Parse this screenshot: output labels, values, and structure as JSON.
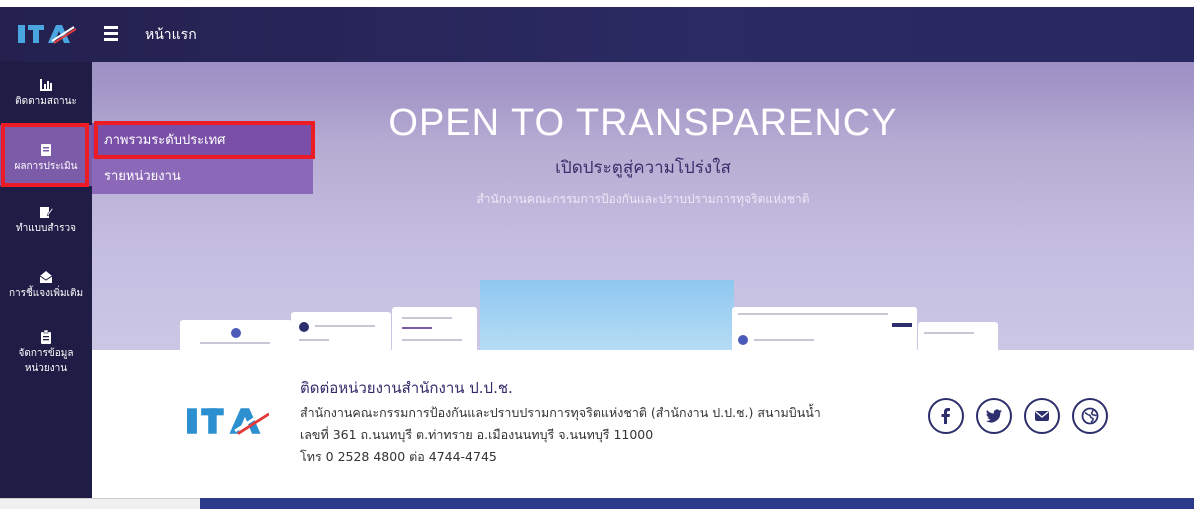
{
  "header": {
    "title": "หน้าแรก"
  },
  "sidebar": {
    "items": [
      {
        "label": "ติดตามสถานะ",
        "icon": "chart-icon"
      },
      {
        "label": "ผลการประเมิน",
        "icon": "document-icon"
      },
      {
        "label": "ทำแบบสำรวจ",
        "icon": "edit-icon"
      },
      {
        "label": "การชี้แจงเพิ่มเติม",
        "icon": "mail-open-icon"
      },
      {
        "label": "จัดการข้อมูล",
        "label2": "หน่วยงาน",
        "icon": "clipboard-icon"
      }
    ]
  },
  "submenu": {
    "items": [
      {
        "label": "ภาพรวมระดับประเทศ"
      },
      {
        "label": "รายหน่วยงาน"
      }
    ]
  },
  "hero": {
    "title": "OPEN TO TRANSPARENCY",
    "subtitle": "เปิดประตูสู่ความโปร่งใส",
    "org": "สำนักงานคณะกรรมการป้องกันและปราบปรามการทุจริตแห่งชาติ"
  },
  "contact": {
    "title": "ติดต่อหน่วยงานสำนักงาน ป.ป.ช.",
    "line1": "สำนักงานคณะกรรมการป้องกันและปราบปรามการทุจริตแห่งชาติ (สำนักงาน ป.ป.ช.) สนามบินน้ำ",
    "line2": "เลขที่ 361 ถ.นนทบุรี ต.ท่าทราย อ.เมืองนนทบุรี จ.นนทบุรี 11000",
    "line3": "โทร 0 2528 4800 ต่อ 4744-4745"
  },
  "social": [
    "facebook-icon",
    "twitter-icon",
    "email-icon",
    "website-icon"
  ],
  "colors": {
    "topbar": "#24214f",
    "sidebar": "#1f1c45",
    "accent": "#7a4fa8",
    "highlight": "#ed1c24"
  }
}
